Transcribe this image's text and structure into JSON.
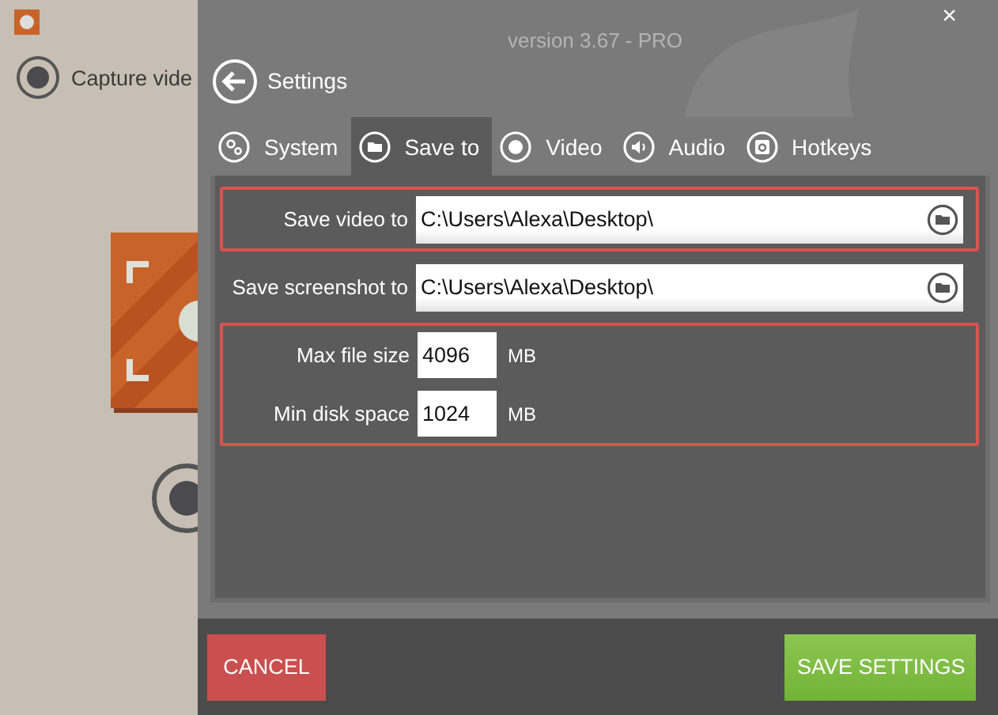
{
  "background": {
    "capture_label": "Capture vide"
  },
  "settings": {
    "version": "version 3.67 - PRO",
    "close": "×",
    "title": "Settings",
    "tabs": [
      {
        "label": "System",
        "kind": "gears",
        "selected": false
      },
      {
        "label": "Save to",
        "kind": "folder",
        "selected": true
      },
      {
        "label": "Video",
        "kind": "record",
        "selected": false
      },
      {
        "label": "Audio",
        "kind": "speaker",
        "selected": false
      },
      {
        "label": "Hotkeys",
        "kind": "key",
        "selected": false
      }
    ],
    "groups": [
      {
        "highlighted": true,
        "rows": [
          {
            "kind": "path",
            "label": "Save video to",
            "value": "C:\\Users\\Alexa\\Desktop\\"
          }
        ]
      },
      {
        "highlighted": false,
        "rows": [
          {
            "kind": "path",
            "label": "Save screenshot to",
            "value": "C:\\Users\\Alexa\\Desktop\\"
          }
        ]
      },
      {
        "highlighted": true,
        "rows": [
          {
            "kind": "number",
            "label": "Max file size",
            "value": "4096",
            "unit": "MB"
          },
          {
            "kind": "number",
            "label": "Min disk space",
            "value": "1024",
            "unit": "MB"
          }
        ]
      }
    ],
    "buttons": [
      {
        "kind": "cancel",
        "label": "CANCEL"
      },
      {
        "kind": "save",
        "label": "SAVE SETTINGS"
      }
    ]
  }
}
